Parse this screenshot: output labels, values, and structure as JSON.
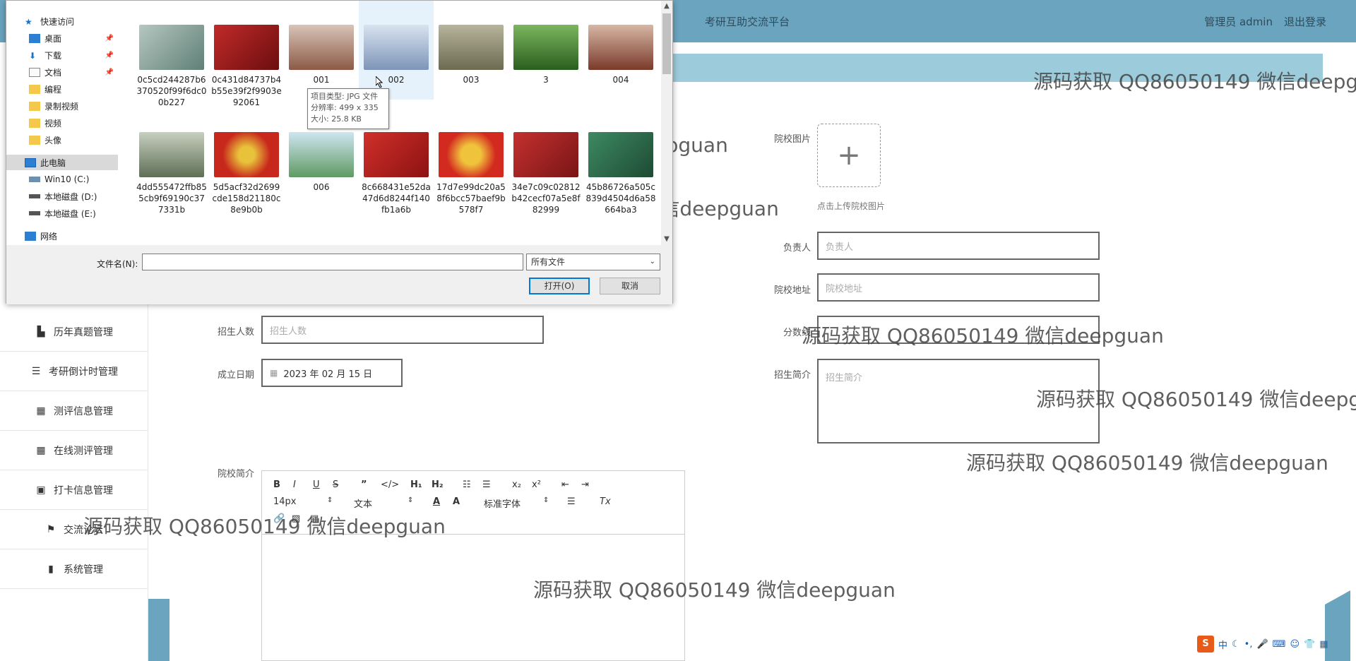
{
  "header": {
    "title": "考研互助交流平台",
    "user": "管理员 admin",
    "logout": "退出登录"
  },
  "sidebar": {
    "items": [
      {
        "label": "历年真题管理",
        "icon": "document-icon"
      },
      {
        "label": "考研倒计时管理",
        "icon": "list-icon"
      },
      {
        "label": "测评信息管理",
        "icon": "grid-icon"
      },
      {
        "label": "在线测评管理",
        "icon": "grid-icon"
      },
      {
        "label": "打卡信息管理",
        "icon": "clipboard-icon"
      },
      {
        "label": "交流论坛",
        "icon": "flag-icon"
      },
      {
        "label": "系统管理",
        "icon": "bars-icon"
      }
    ]
  },
  "form": {
    "image_label": "院校图片",
    "upload_tip": "点击上传院校图片",
    "person_label": "负责人",
    "person_placeholder": "负责人",
    "address_label": "院校地址",
    "address_placeholder": "院校地址",
    "score_label": "分数线",
    "intro_label": "招生简介",
    "intro_placeholder": "招生简介",
    "enroll_label": "招生人数",
    "enroll_placeholder": "招生人数",
    "date_label": "成立日期",
    "date_value": "2023 年 02 月 15 日",
    "school_intro_label": "院校简介"
  },
  "editor": {
    "font_size": "14px",
    "paragraph": "文本",
    "font_family": "标准字体"
  },
  "dialog": {
    "nav": [
      {
        "label": "快速访问",
        "icon": "star-icon"
      },
      {
        "label": "桌面",
        "icon": "desktop-icon",
        "pinned": true
      },
      {
        "label": "下载",
        "icon": "download-icon",
        "pinned": true
      },
      {
        "label": "文档",
        "icon": "document-icon",
        "pinned": true
      },
      {
        "label": "编程",
        "icon": "folder-icon"
      },
      {
        "label": "录制视频",
        "icon": "folder-icon"
      },
      {
        "label": "视频",
        "icon": "folder-icon"
      },
      {
        "label": "头像",
        "icon": "folder-icon"
      },
      {
        "label": "此电脑",
        "icon": "computer-icon"
      },
      {
        "label": "Win10 (C:)",
        "icon": "drive-icon"
      },
      {
        "label": "本地磁盘 (D:)",
        "icon": "drive-icon"
      },
      {
        "label": "本地磁盘 (E:)",
        "icon": "drive-icon"
      },
      {
        "label": "网络",
        "icon": "network-icon"
      }
    ],
    "files": [
      {
        "name": "0c5cd244287b6370520f99f6dc00b227",
        "color": "#7fa29a"
      },
      {
        "name": "0c431d84737b4b55e39f2f9903e92061",
        "color": "#9c1a1a"
      },
      {
        "name": "001",
        "color": "#a0705a"
      },
      {
        "name": "002",
        "color": "#8ea5c4"
      },
      {
        "name": "003",
        "color": "#8f8a6e"
      },
      {
        "name": "3",
        "color": "#3f7a2f"
      },
      {
        "name": "004",
        "color": "#8a4a3a"
      },
      {
        "name": "4dd555472ffb855cb9f69190c377331b",
        "color": "#7b8a72"
      },
      {
        "name": "5d5acf32d2699cde158d21180c8e9b0b",
        "color": "#c8281c"
      },
      {
        "name": "006",
        "color": "#6fa071"
      },
      {
        "name": "8c668431e52da47d6d8244f140fb1a6b",
        "color": "#b51e1e"
      },
      {
        "name": "17d7e99dc20a58f6bcc57baef9b578f7",
        "color": "#d32a1f"
      },
      {
        "name": "34e7c09c02812b42cecf07a5e8f82999",
        "color": "#b8262a"
      },
      {
        "name": "45b86726a505c839d4504d6a58664ba3",
        "color": "#2f6e4e"
      }
    ],
    "tooltip": {
      "type": "项目类型: JPG 文件",
      "resolution": "分辨率: 499 x 335",
      "size": "大小: 25.8 KB"
    },
    "filename_label": "文件名(N):",
    "filetype": "所有文件",
    "open_button": "打开(O)",
    "cancel_button": "取消"
  },
  "watermark": "源码获取 QQ86050149 微信deepguan",
  "tray": {
    "ime": "中",
    "brand": "S"
  }
}
